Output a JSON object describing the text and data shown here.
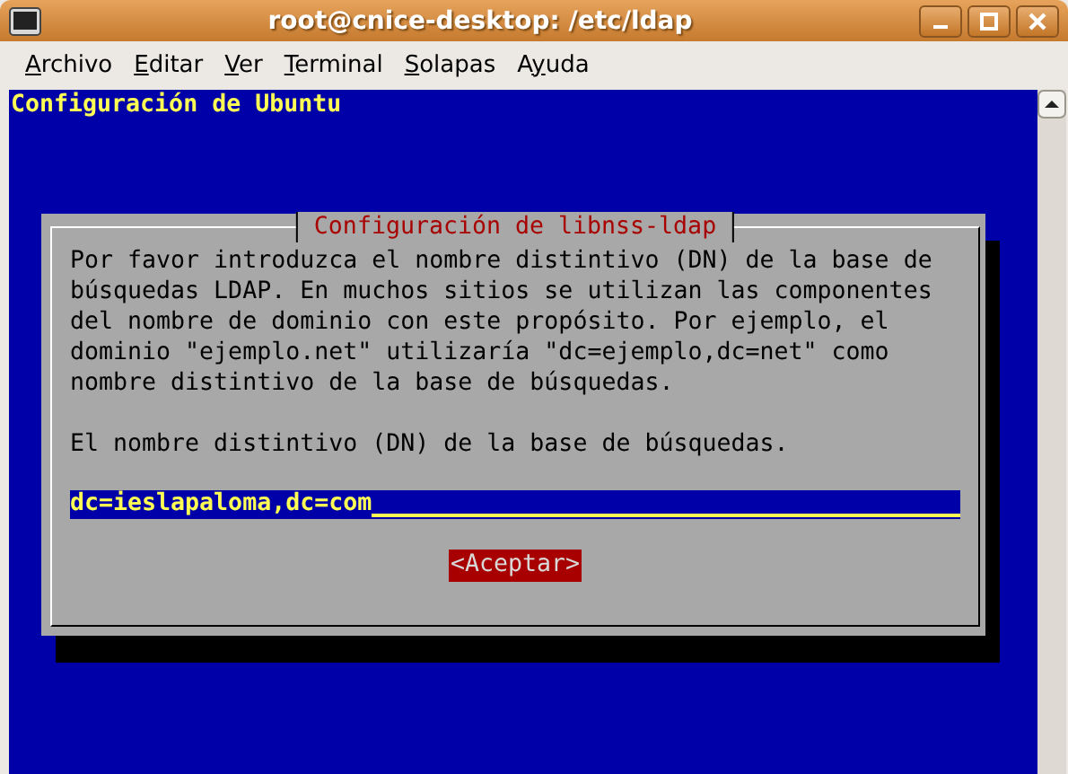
{
  "window": {
    "title": "root@cnice-desktop: /etc/ldap"
  },
  "menu": [
    {
      "access_key": "A",
      "after": "rchivo"
    },
    {
      "access_key": "E",
      "after": "ditar"
    },
    {
      "access_key": "V",
      "after": "er"
    },
    {
      "access_key": "T",
      "after": "erminal"
    },
    {
      "access_key": "S",
      "after": "olapas"
    },
    {
      "before": "A",
      "access_key": "y",
      "after": "uda"
    }
  ],
  "terminal": {
    "backtitle": "Configuración de Ubuntu",
    "dialog": {
      "title": "Configuración de libnss-ldap",
      "description": [
        "Por favor introduzca el nombre distintivo (DN) de la base de",
        "búsquedas LDAP. En muchos sitios se utilizan las componentes",
        "del nombre de dominio con este propósito. Por ejemplo, el",
        "dominio \"ejemplo.net\" utilizaría \"dc=ejemplo,dc=net\" como",
        "nombre distintivo de la base de búsquedas."
      ],
      "prompt": "El nombre distintivo (DN) de la base de búsquedas.",
      "input": {
        "value": "dc=ieslapaloma,dc=com"
      },
      "buttons": [
        {
          "label": "<Aceptar>",
          "selected": true
        }
      ]
    }
  }
}
